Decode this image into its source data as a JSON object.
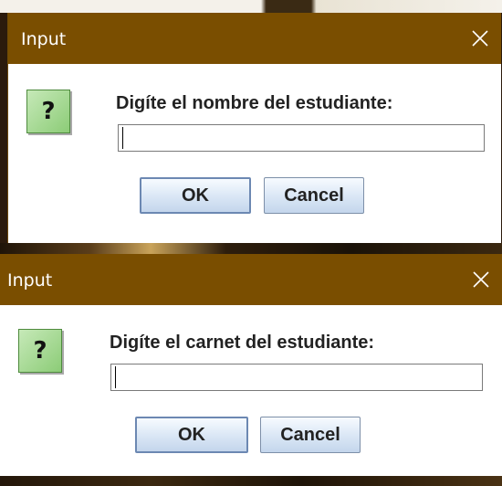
{
  "dialogs": [
    {
      "title": "Input",
      "prompt": "Digíte el nombre del estudiante:",
      "input_value": "",
      "ok_label": "OK",
      "cancel_label": "Cancel",
      "icon": "question-icon",
      "icon_glyph": "?"
    },
    {
      "title": "Input",
      "prompt": "Digíte el carnet del estudiante:",
      "input_value": "",
      "ok_label": "OK",
      "cancel_label": "Cancel",
      "icon": "question-icon",
      "icon_glyph": "?"
    }
  ],
  "colors": {
    "titlebar": "#7a4e00",
    "dialog_bg": "#ffffff",
    "icon_green": "#8ccc77",
    "button_blue": "#d9e6f5"
  }
}
